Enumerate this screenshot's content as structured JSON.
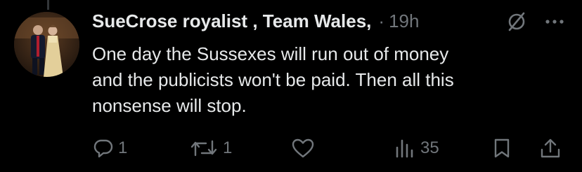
{
  "tweet": {
    "author": {
      "display_name": "SueCrose royalist , Team Wales,",
      "avatar_icon": "avatar-photo"
    },
    "separator": "·",
    "time": "19h",
    "text_lines": [
      "One day the Sussexes will run out of money",
      "and the publicists won't be paid. Then all this",
      "nonsense will stop."
    ],
    "header_icons": [
      "grok-icon",
      "more-icon"
    ],
    "actions": {
      "reply": {
        "icon": "reply-icon",
        "count": "1"
      },
      "repost": {
        "icon": "repost-icon",
        "count": "1"
      },
      "like": {
        "icon": "like-icon",
        "count": ""
      },
      "views": {
        "icon": "views-icon",
        "count": "35"
      },
      "bookmark": {
        "icon": "bookmark-icon"
      },
      "share": {
        "icon": "share-icon"
      }
    }
  },
  "colors": {
    "background": "#000000",
    "primary_text": "#e7e9ea",
    "secondary_text": "#71767b",
    "thread_line": "#333639"
  }
}
